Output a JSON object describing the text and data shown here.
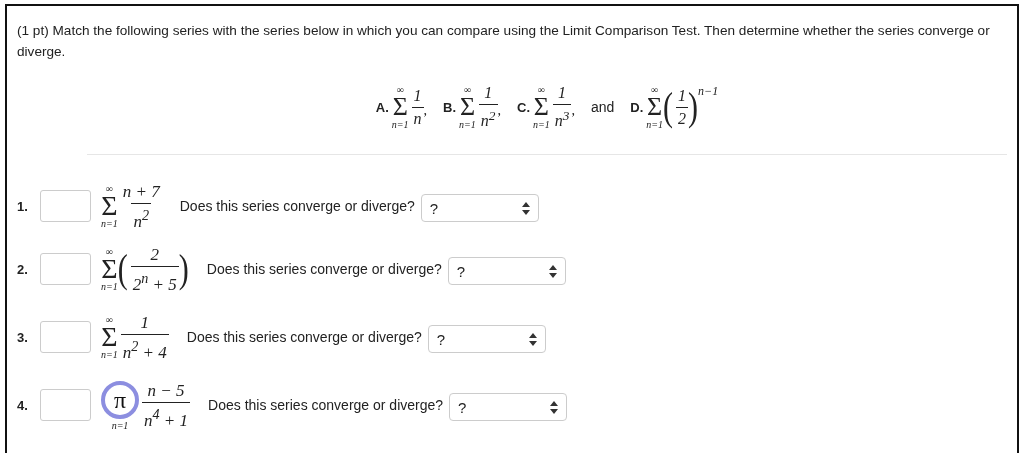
{
  "instructions": "(1 pt) Match the following series with the series below in which you can compare using the Limit Comparison Test. Then determine whether the series converge or diverge.",
  "options": [
    {
      "kind": "series",
      "label": "A.",
      "upper": "∞",
      "symbol": "Σ",
      "lower": "n=1",
      "numerator": "1",
      "denominator": "n",
      "suffix": ","
    },
    {
      "kind": "series",
      "label": "B.",
      "upper": "∞",
      "symbol": "Σ",
      "lower": "n=1",
      "numerator": "1",
      "denominator": "n$^{2}$",
      "suffix": ","
    },
    {
      "kind": "series",
      "label": "C.",
      "upper": "∞",
      "symbol": "Σ",
      "lower": "n=1",
      "numerator": "1",
      "denominator": "n$^{3}$",
      "suffix": ","
    },
    {
      "kind": "word",
      "text": "and"
    },
    {
      "kind": "series",
      "label": "D.",
      "upper": "∞",
      "symbol": "Σ",
      "lower": "n=1",
      "open": "(",
      "numerator": "1",
      "denominator": "2",
      "close": ")",
      "exponent": "n−1"
    }
  ],
  "problems": [
    {
      "number": "1.",
      "upper": "∞",
      "symbol": "Σ",
      "lower": "n=1",
      "numerator": "n + 7",
      "denominator": "n$^{2}$",
      "question": "Does this series converge or diverge?",
      "answer": "?"
    },
    {
      "number": "2.",
      "upper": "∞",
      "symbol": "Σ",
      "lower": "n=1",
      "open": "(",
      "numerator": "2",
      "denominator": "2$^{n}$ + 5",
      "close": ")",
      "question": "Does this series converge or diverge?",
      "answer": "?"
    },
    {
      "number": "3.",
      "upper": "∞",
      "symbol": "Σ",
      "lower": "n=1",
      "numerator": "1",
      "denominator": "n$^{2}$ + 4",
      "question": "Does this series converge or diverge?",
      "answer": "?"
    },
    {
      "number": "4.",
      "equation_button": "π",
      "lower": "n=1",
      "numerator": "n − 5",
      "denominator": "n$^{4}$ + 1",
      "question": "Does this series converge or diverge?",
      "answer": "?"
    }
  ]
}
